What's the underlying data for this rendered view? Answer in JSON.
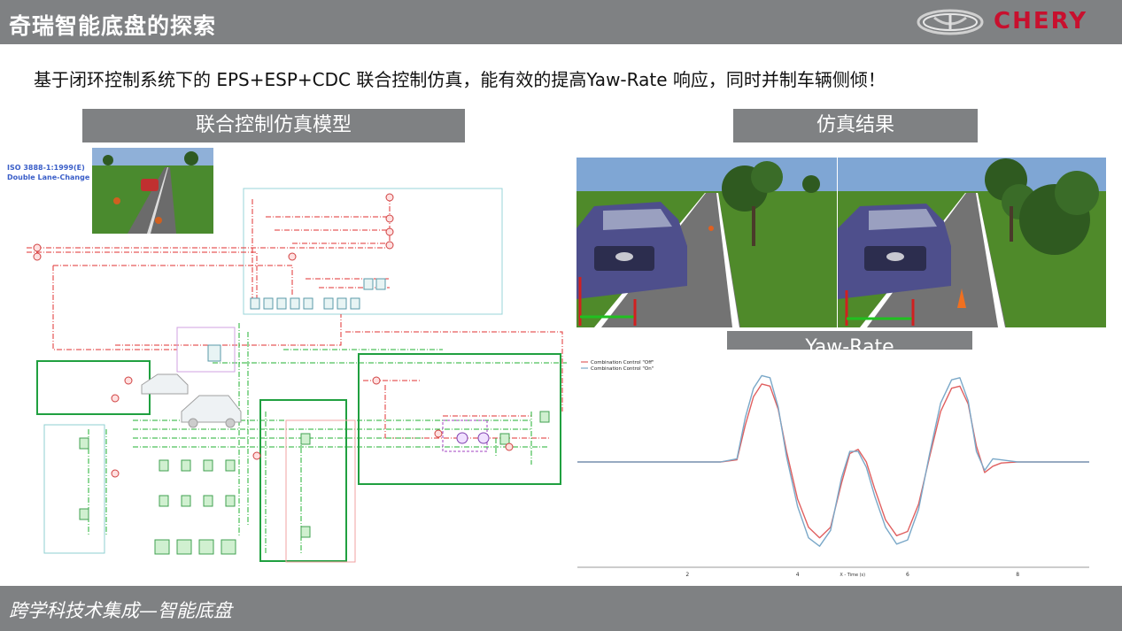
{
  "header": {
    "title": "奇瑞智能底盘的探索",
    "brand": "CHERY",
    "bar_color": "#7f8183",
    "brand_color": "#c8102e"
  },
  "headline": "基于闭环控制系统下的 EPS+ESP+CDC 联合控制仿真，能有效的提高Yaw-Rate 响应，同时并制车辆侧倾！",
  "left_section": {
    "label": "联合控制仿真模型",
    "iso_label_1": "ISO 3888-1:1999(E)",
    "iso_label_2": "Double Lane-Change"
  },
  "right_section": {
    "label": "仿真结果",
    "chart_label": "Yaw-Rate"
  },
  "footer": {
    "text": "跨学科技术集成—智能底盘"
  },
  "chart_data": {
    "type": "line",
    "title": "",
    "xlabel": "X - Time (s)",
    "ylabel": "",
    "legend_position": "top-left",
    "x_ticks": [
      "2",
      "4",
      "6",
      "8"
    ],
    "xlim": [
      0,
      9.3
    ],
    "ylim": [
      -1.0,
      1.0
    ],
    "grid": false,
    "series": [
      {
        "name": "Combination Control \"Off\"",
        "color": "#e06060",
        "points": [
          [
            0,
            0
          ],
          [
            1,
            0
          ],
          [
            2,
            0
          ],
          [
            2.6,
            0
          ],
          [
            2.9,
            0.02
          ],
          [
            3.05,
            0.35
          ],
          [
            3.2,
            0.62
          ],
          [
            3.35,
            0.74
          ],
          [
            3.5,
            0.72
          ],
          [
            3.65,
            0.5
          ],
          [
            3.8,
            0.1
          ],
          [
            4.0,
            -0.35
          ],
          [
            4.2,
            -0.62
          ],
          [
            4.4,
            -0.72
          ],
          [
            4.6,
            -0.62
          ],
          [
            4.8,
            -0.2
          ],
          [
            4.95,
            0.08
          ],
          [
            5.1,
            0.12
          ],
          [
            5.25,
            0.0
          ],
          [
            5.4,
            -0.25
          ],
          [
            5.6,
            -0.55
          ],
          [
            5.8,
            -0.7
          ],
          [
            6.0,
            -0.66
          ],
          [
            6.2,
            -0.4
          ],
          [
            6.4,
            0.05
          ],
          [
            6.6,
            0.48
          ],
          [
            6.8,
            0.7
          ],
          [
            6.95,
            0.72
          ],
          [
            7.1,
            0.55
          ],
          [
            7.25,
            0.15
          ],
          [
            7.4,
            -0.1
          ],
          [
            7.55,
            -0.04
          ],
          [
            7.7,
            -0.01
          ],
          [
            8.0,
            0
          ],
          [
            9.3,
            0
          ]
        ]
      },
      {
        "name": "Combination Control \"On\"",
        "color": "#7aa8c8",
        "points": [
          [
            0,
            0
          ],
          [
            1,
            0
          ],
          [
            2,
            0
          ],
          [
            2.6,
            0
          ],
          [
            2.9,
            0.03
          ],
          [
            3.05,
            0.42
          ],
          [
            3.2,
            0.7
          ],
          [
            3.35,
            0.82
          ],
          [
            3.5,
            0.8
          ],
          [
            3.65,
            0.52
          ],
          [
            3.8,
            0.05
          ],
          [
            4.0,
            -0.42
          ],
          [
            4.2,
            -0.72
          ],
          [
            4.4,
            -0.8
          ],
          [
            4.6,
            -0.65
          ],
          [
            4.8,
            -0.15
          ],
          [
            4.95,
            0.1
          ],
          [
            5.1,
            0.1
          ],
          [
            5.25,
            -0.05
          ],
          [
            5.4,
            -0.32
          ],
          [
            5.6,
            -0.62
          ],
          [
            5.8,
            -0.78
          ],
          [
            6.0,
            -0.74
          ],
          [
            6.2,
            -0.45
          ],
          [
            6.4,
            0.08
          ],
          [
            6.6,
            0.56
          ],
          [
            6.8,
            0.78
          ],
          [
            6.95,
            0.8
          ],
          [
            7.1,
            0.58
          ],
          [
            7.25,
            0.1
          ],
          [
            7.4,
            -0.08
          ],
          [
            7.55,
            0.03
          ],
          [
            7.7,
            0.02
          ],
          [
            8.0,
            0
          ],
          [
            9.3,
            0
          ]
        ]
      }
    ]
  }
}
